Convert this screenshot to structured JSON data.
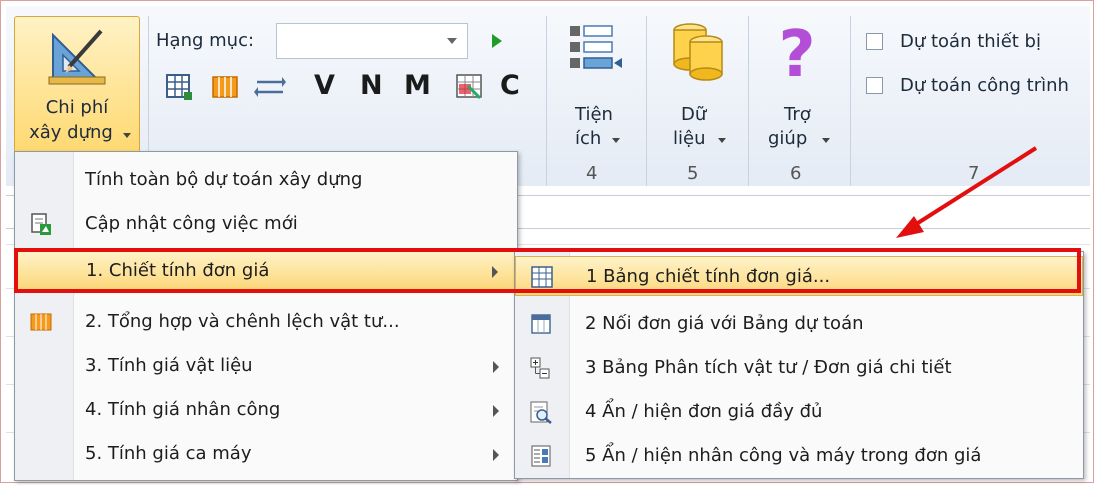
{
  "ribbon": {
    "chi_phi_line1": "Chi phí",
    "chi_phi_line2": "xây dựng",
    "hang_muc_label": "Hạng mục:",
    "hang_muc_value": "",
    "tool_letters": [
      "V",
      "N",
      "M",
      "C"
    ],
    "tien_ich_line1": "Tiện",
    "tien_ich_line2": "ích",
    "du_lieu_line1": "Dữ",
    "du_lieu_line2": "liệu",
    "tro_giup_line1": "Trợ",
    "tro_giup_line2": "giúp",
    "group_numbers": [
      "4",
      "5",
      "6",
      "7"
    ],
    "check_thiet_bi": "Dự toán thiết bị",
    "check_cong_trinh": "Dự toán công trình"
  },
  "menu": {
    "items": [
      {
        "label": "Tính toàn bộ dự toán xây dựng"
      },
      {
        "label": "Cập nhật công việc mới"
      },
      {
        "label": "1. Chiết tính đơn giá"
      },
      {
        "label": "2. Tổng hợp và chênh lệch vật tư..."
      },
      {
        "label": "3. Tính giá vật liệu"
      },
      {
        "label": "4. Tính giá nhân công"
      },
      {
        "label": "5. Tính giá ca máy"
      }
    ]
  },
  "submenu": {
    "items": [
      {
        "label": "1 Bảng chiết tính đơn giá..."
      },
      {
        "label": "2 Nối đơn giá với Bảng dự toán"
      },
      {
        "label": "3 Bảng Phân tích vật tư / Đơn giá chi tiết"
      },
      {
        "label": "4 Ẩn / hiện đơn giá đầy đủ"
      },
      {
        "label": "5 Ẩn / hiện nhân công và máy trong đơn giá"
      }
    ]
  },
  "colors": {
    "highlight_border": "#e30e0e",
    "selected_bg": "#fcd77a",
    "arrow": "#e30e0e"
  }
}
